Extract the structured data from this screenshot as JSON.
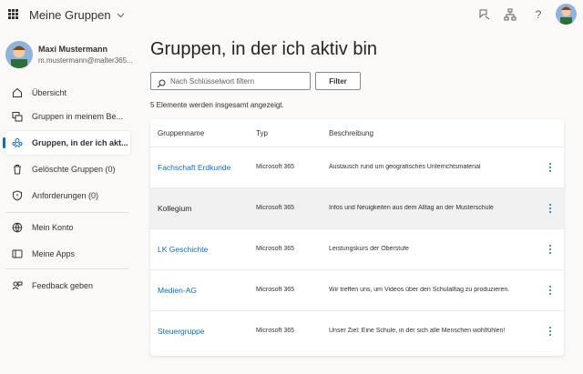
{
  "header": {
    "app_title": "Meine Gruppen",
    "icons": [
      "waffle-icon",
      "feedback-icon",
      "org-icon",
      "help-icon",
      "avatar"
    ]
  },
  "profile": {
    "name": "Maxi Mustermann",
    "email": "m.mustermann@malter365..."
  },
  "sidebar": {
    "items": [
      {
        "label": "Übersicht",
        "icon": "home-icon"
      },
      {
        "label": "Gruppen in meinem Be...",
        "icon": "groups-owned-icon"
      },
      {
        "label": "Gruppen, in der ich akt...",
        "icon": "groups-member-icon",
        "active": true
      },
      {
        "label": "Gelöschte Gruppen (0)",
        "icon": "trash-icon"
      },
      {
        "label": "Anforderungen (0)",
        "icon": "shield-icon"
      },
      {
        "label": "Mein Konto",
        "icon": "globe-icon"
      },
      {
        "label": "Meine Apps",
        "icon": "apps-icon"
      },
      {
        "label": "Feedback geben",
        "icon": "feedback-icon"
      }
    ]
  },
  "main": {
    "title": "Gruppen, in der ich aktiv bin",
    "search_placeholder": "Nach Schlüsselwort filtern",
    "filter_label": "Filter",
    "count_text": "5 Elemente werden insgesamt angezeigt.",
    "table": {
      "headers": [
        "Gruppenname",
        "Typ",
        "Beschreibung"
      ],
      "rows": [
        {
          "name": "Fachschaft Erdkunde",
          "type": "Microsoft 365",
          "description": "Austausch rund um geografisches Unterrichtsmaterial"
        },
        {
          "name": "Kollegium",
          "type": "Microsoft 365",
          "description": "Infos und Neuigkeiten aus dem Alltag an der Musterschule",
          "selected": true
        },
        {
          "name": "LK Geschichte",
          "type": "Microsoft 365",
          "description": "Leistungskurs der Oberstufe"
        },
        {
          "name": "Medien-AG",
          "type": "Microsoft 365",
          "description": "Wir treffen uns, um Videos über den Schulalltag zu produzieren."
        },
        {
          "name": "Steuergruppe",
          "type": "Microsoft 365",
          "description": "Unser Ziel: Eine Schule, in der sich alle Menschen wohlfühlen!"
        }
      ]
    }
  },
  "colors": {
    "accent": "#0f6cbd",
    "background": "#faf9f8",
    "selected_row": "#f0f0f0"
  }
}
